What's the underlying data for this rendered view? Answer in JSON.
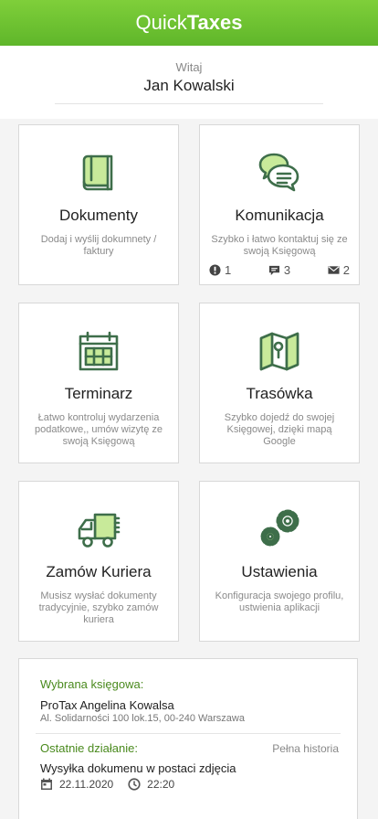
{
  "header": {
    "title_light": "Quick",
    "title_bold": "Taxes"
  },
  "greeting": {
    "hello": "Witaj",
    "name": "Jan Kowalski"
  },
  "tiles": {
    "dokumenty": {
      "title": "Dokumenty",
      "desc": "Dodaj i wyślij dokumnety / faktury",
      "icon": "documents-icon"
    },
    "komunikacja": {
      "title": "Komunikacja",
      "desc": "Szybko i łatwo kontaktuj się ze swoją Księgową",
      "icon": "chat-icon",
      "badges": {
        "alerts": "1",
        "messages": "3",
        "mail": "2"
      }
    },
    "terminarz": {
      "title": "Terminarz",
      "desc": "Łatwo kontroluj wydarzenia podatkowe,, umów wizytę ze swoją Księgową",
      "icon": "calendar-icon"
    },
    "trasowka": {
      "title": "Trasówka",
      "desc": "Szybko dojedź do swojej Księgowej, dzięki mapą Google",
      "icon": "map-icon"
    },
    "kurier": {
      "title": "Zamów Kuriera",
      "desc": "Musisz wysłać dokumenty tradycyjnie, szybko zamów kuriera",
      "icon": "truck-icon"
    },
    "ustawienia": {
      "title": "Ustawienia",
      "desc": "Konfiguracja swojego profilu, ustwienia aplikacji",
      "icon": "gears-icon"
    }
  },
  "info": {
    "accountant_label": "Wybrana księgowa:",
    "accountant_name": "ProTax Angelina Kowalsa",
    "accountant_address": "Al. Solidarności 100 lok.15, 00-240 Warszawa",
    "last_label": "Ostatnie działanie:",
    "history_link": "Pełna historia",
    "last_action": "Wysyłka dokumenu w postaci zdjęcia",
    "date": "22.11.2020",
    "time": "22:20"
  },
  "colors": {
    "accent": "#5fb62a",
    "icon_stroke": "#3e6e4a",
    "icon_fill": "#c8ea9a"
  }
}
